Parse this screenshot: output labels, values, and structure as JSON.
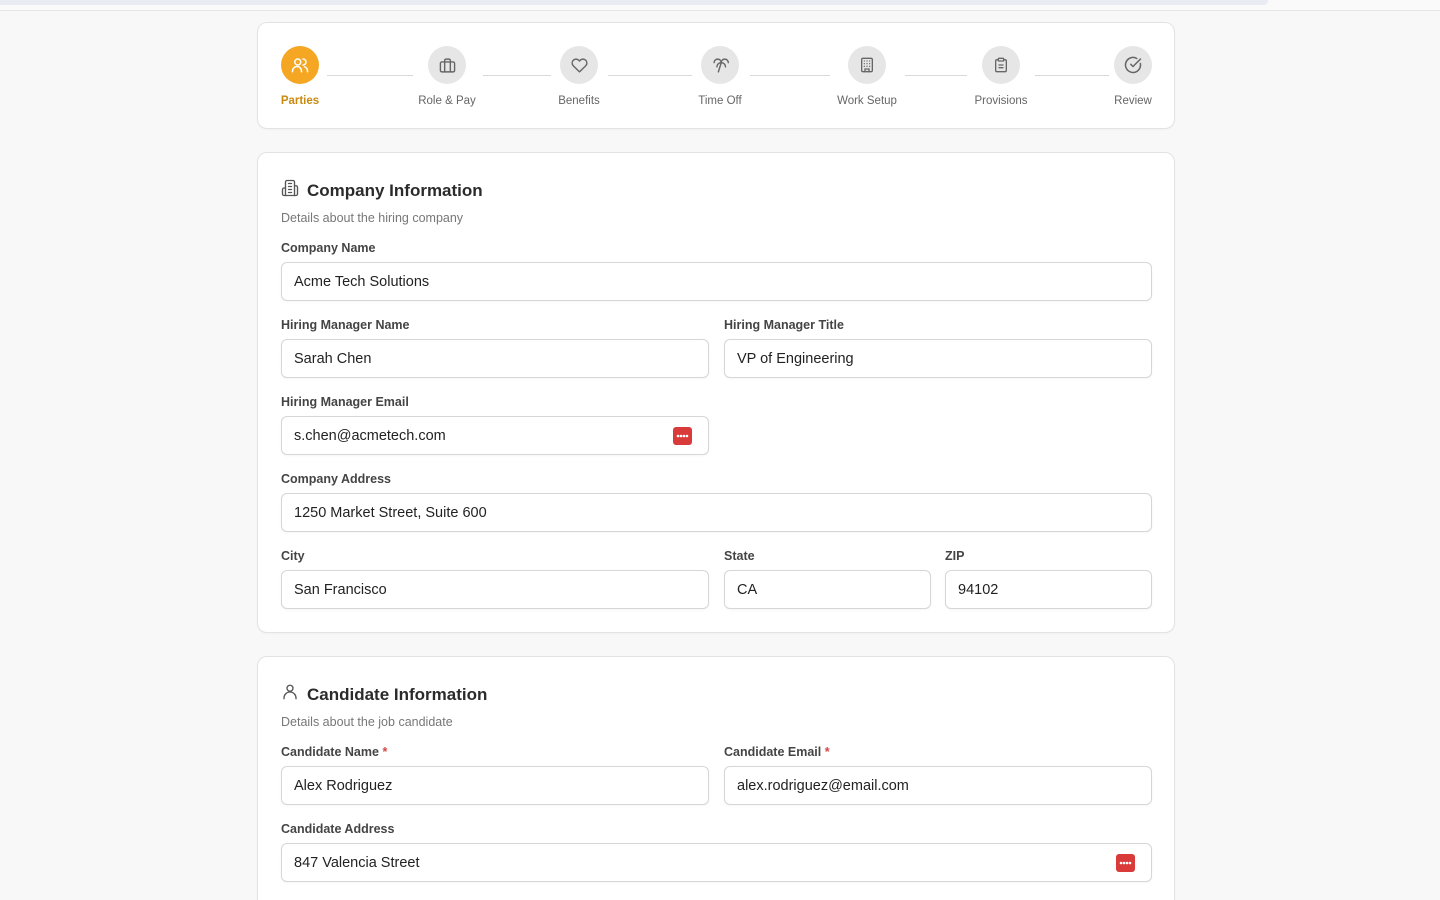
{
  "stepper": {
    "steps": [
      {
        "label": "Parties",
        "icon": "users-icon",
        "active": true
      },
      {
        "label": "Role & Pay",
        "icon": "briefcase-icon",
        "active": false
      },
      {
        "label": "Benefits",
        "icon": "heart-icon",
        "active": false
      },
      {
        "label": "Time Off",
        "icon": "palm-tree-icon",
        "active": false
      },
      {
        "label": "Work Setup",
        "icon": "building-icon",
        "active": false
      },
      {
        "label": "Provisions",
        "icon": "clipboard-icon",
        "active": false
      },
      {
        "label": "Review",
        "icon": "check-circle-icon",
        "active": false
      }
    ],
    "active_color": "#f5a623"
  },
  "company": {
    "title": "Company Information",
    "subtitle": "Details about the hiring company",
    "icon": "building-icon",
    "fields": {
      "company_name": {
        "label": "Company Name",
        "value": "Acme Tech Solutions"
      },
      "manager_name": {
        "label": "Hiring Manager Name",
        "value": "Sarah Chen"
      },
      "manager_title": {
        "label": "Hiring Manager Title",
        "value": "VP of Engineering"
      },
      "manager_email": {
        "label": "Hiring Manager Email",
        "value": "s.chen@acmetech.com"
      },
      "address": {
        "label": "Company Address",
        "value": "1250 Market Street, Suite 600"
      },
      "city": {
        "label": "City",
        "value": "San Francisco"
      },
      "state": {
        "label": "State",
        "value": "CA"
      },
      "zip": {
        "label": "ZIP",
        "value": "94102"
      }
    }
  },
  "candidate": {
    "title": "Candidate Information",
    "subtitle": "Details about the job candidate",
    "icon": "user-icon",
    "fields": {
      "name": {
        "label": "Candidate Name",
        "required_mark": "*",
        "value": "Alex Rodriguez"
      },
      "email": {
        "label": "Candidate Email",
        "required_mark": "*",
        "value": "alex.rodriguez@email.com"
      },
      "address": {
        "label": "Candidate Address",
        "value": "847 Valencia Street"
      }
    }
  },
  "password_manager_icon": "password-manager-icon",
  "colors": {
    "required": "#d64545",
    "badge": "#d93a3a"
  }
}
